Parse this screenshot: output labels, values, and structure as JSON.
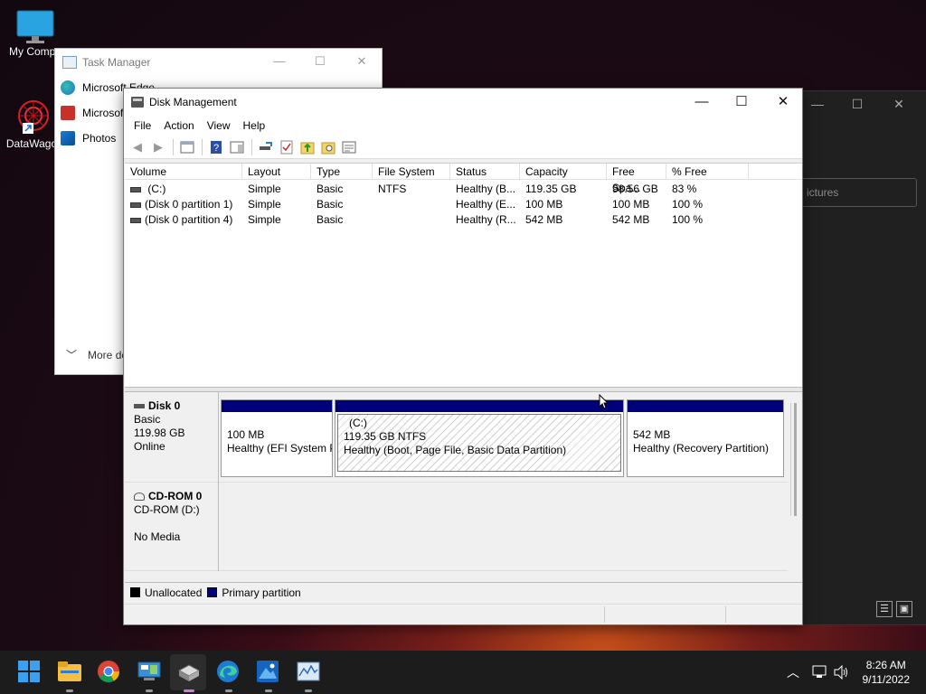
{
  "desktop": {
    "icons": [
      {
        "label": "My Compu",
        "icon": "monitor-icon"
      },
      {
        "label": "DataWago",
        "icon": "datawagon-icon"
      }
    ]
  },
  "background_window": {
    "search_placeholder": "ictures"
  },
  "task_manager": {
    "title": "Task Manager",
    "items": [
      {
        "label": "Microsoft Edge",
        "icon": "edge-icon"
      },
      {
        "label": "Microsof",
        "icon": "store-icon"
      },
      {
        "label": "Photos",
        "icon": "photos-icon"
      }
    ],
    "more_details": "More de"
  },
  "disk_management": {
    "title": "Disk Management",
    "menu": [
      "File",
      "Action",
      "View",
      "Help"
    ],
    "toolbar": [
      "back-icon",
      "forward-icon",
      "properties-icon",
      "help-icon",
      "console-tree-icon",
      "connect-icon",
      "check-icon",
      "up-icon",
      "search-icon",
      "list-icon"
    ],
    "columns": [
      "Volume",
      "Layout",
      "Type",
      "File System",
      "Status",
      "Capacity",
      "Free Spa...",
      "% Free"
    ],
    "volumes": [
      {
        "volume": " (C:)",
        "layout": "Simple",
        "type": "Basic",
        "fs": "NTFS",
        "status": "Healthy (B...",
        "capacity": "119.35 GB",
        "free": "98.56 GB",
        "pct": "83 %"
      },
      {
        "volume": "(Disk 0 partition 1)",
        "layout": "Simple",
        "type": "Basic",
        "fs": "",
        "status": "Healthy (E...",
        "capacity": "100 MB",
        "free": "100 MB",
        "pct": "100 %"
      },
      {
        "volume": "(Disk 0 partition 4)",
        "layout": "Simple",
        "type": "Basic",
        "fs": "",
        "status": "Healthy (R...",
        "capacity": "542 MB",
        "free": "542 MB",
        "pct": "100 %"
      }
    ],
    "disks": [
      {
        "name": "Disk 0",
        "type": "Basic",
        "size": "119.98 GB",
        "state": "Online",
        "partitions": [
          {
            "line1": "",
            "line2": "100 MB",
            "line3": "Healthy (EFI System P"
          },
          {
            "line1": "(C:)",
            "line2": "119.35 GB NTFS",
            "line3": "Healthy (Boot, Page File, Basic Data Partition)"
          },
          {
            "line1": "",
            "line2": "542 MB",
            "line3": "Healthy (Recovery Partition)"
          }
        ]
      },
      {
        "name": "CD-ROM 0",
        "type": "CD-ROM (D:)",
        "size": "",
        "state": "No Media"
      }
    ],
    "legend": [
      {
        "label": "Unallocated",
        "color": "#000000"
      },
      {
        "label": "Primary partition",
        "color": "#00007b"
      }
    ]
  },
  "taskbar": {
    "apps": [
      "start-icon",
      "file-explorer-icon",
      "chrome-icon",
      "control-panel-icon",
      "disk-management-icon",
      "edge-icon",
      "photos-icon",
      "task-manager-icon"
    ],
    "time": "8:26 AM",
    "date": "9/11/2022"
  }
}
